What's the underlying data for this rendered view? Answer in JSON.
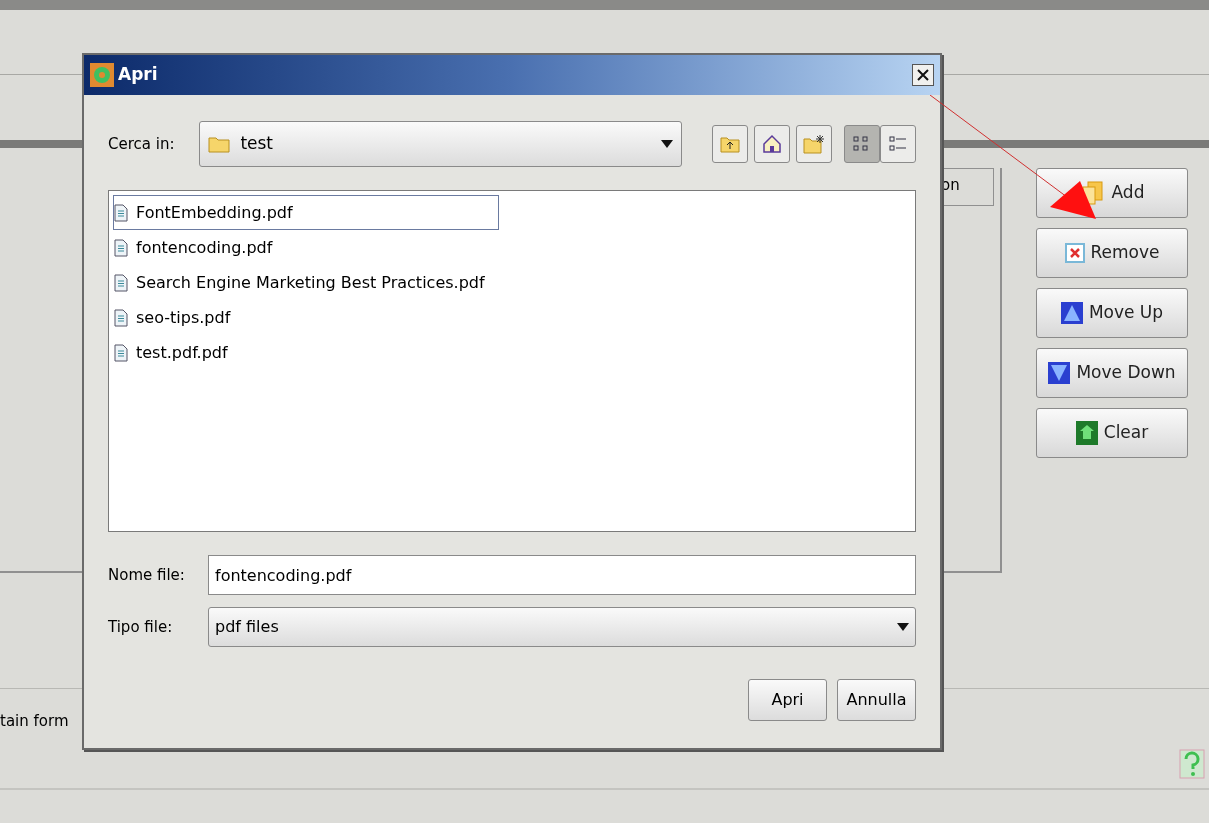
{
  "background": {
    "table_header_fragment": "on",
    "side_buttons": [
      {
        "label": "Add",
        "kind": "add"
      },
      {
        "label": "Remove",
        "kind": "remove"
      },
      {
        "label": "Move Up",
        "kind": "up"
      },
      {
        "label": "Move Down",
        "kind": "down"
      },
      {
        "label": "Clear",
        "kind": "clear"
      }
    ],
    "status_fragment": "tain form"
  },
  "dialog": {
    "title": "Apri",
    "look_in": {
      "label": "Cerca in:",
      "value": "test"
    },
    "view_modes": [
      {
        "kind": "list",
        "selected": true
      },
      {
        "kind": "details",
        "selected": false
      }
    ],
    "files": [
      {
        "name": "FontEmbedding.pdf",
        "selected": true
      },
      {
        "name": "fontencoding.pdf",
        "selected": false
      },
      {
        "name": "Search Engine Marketing Best Practices.pdf",
        "selected": false
      },
      {
        "name": "seo-tips.pdf",
        "selected": false
      },
      {
        "name": "test.pdf.pdf",
        "selected": false
      }
    ],
    "file_name": {
      "label": "Nome file:",
      "value": "fontencoding.pdf"
    },
    "file_type": {
      "label": "Tipo file:",
      "value": "pdf files"
    },
    "buttons": [
      "Apri",
      "Annulla"
    ]
  }
}
